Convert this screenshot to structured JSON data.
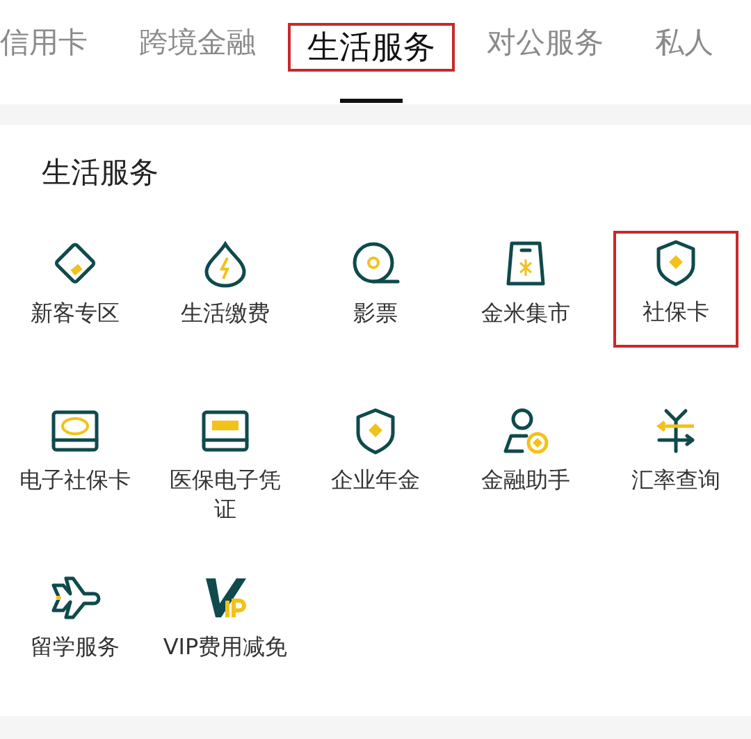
{
  "tabs": [
    {
      "label": "信用卡",
      "selected": false,
      "highlighted": false
    },
    {
      "label": "跨境金融",
      "selected": false,
      "highlighted": false
    },
    {
      "label": "生活服务",
      "selected": true,
      "highlighted": true
    },
    {
      "label": "对公服务",
      "selected": false,
      "highlighted": false
    },
    {
      "label": "私人",
      "selected": false,
      "highlighted": false
    }
  ],
  "section": {
    "title": "生活服务",
    "items": [
      {
        "label": "新客专区",
        "kind": "card",
        "highlighted": false
      },
      {
        "label": "生活缴费",
        "kind": "drop",
        "highlighted": false
      },
      {
        "label": "影票",
        "kind": "reel",
        "highlighted": false
      },
      {
        "label": "金米集市",
        "kind": "bag",
        "highlighted": false
      },
      {
        "label": "社保卡",
        "kind": "shield",
        "highlighted": true
      },
      {
        "label": "电子社保卡",
        "kind": "screen",
        "highlighted": false
      },
      {
        "label": "医保电子凭证",
        "kind": "screen2",
        "highlighted": false
      },
      {
        "label": "企业年金",
        "kind": "shield",
        "highlighted": false
      },
      {
        "label": "金融助手",
        "kind": "person",
        "highlighted": false
      },
      {
        "label": "汇率查询",
        "kind": "yen",
        "highlighted": false
      },
      {
        "label": "留学服务",
        "kind": "plane",
        "highlighted": false
      },
      {
        "label": "VIP费用减免",
        "kind": "vip",
        "highlighted": false
      }
    ]
  }
}
